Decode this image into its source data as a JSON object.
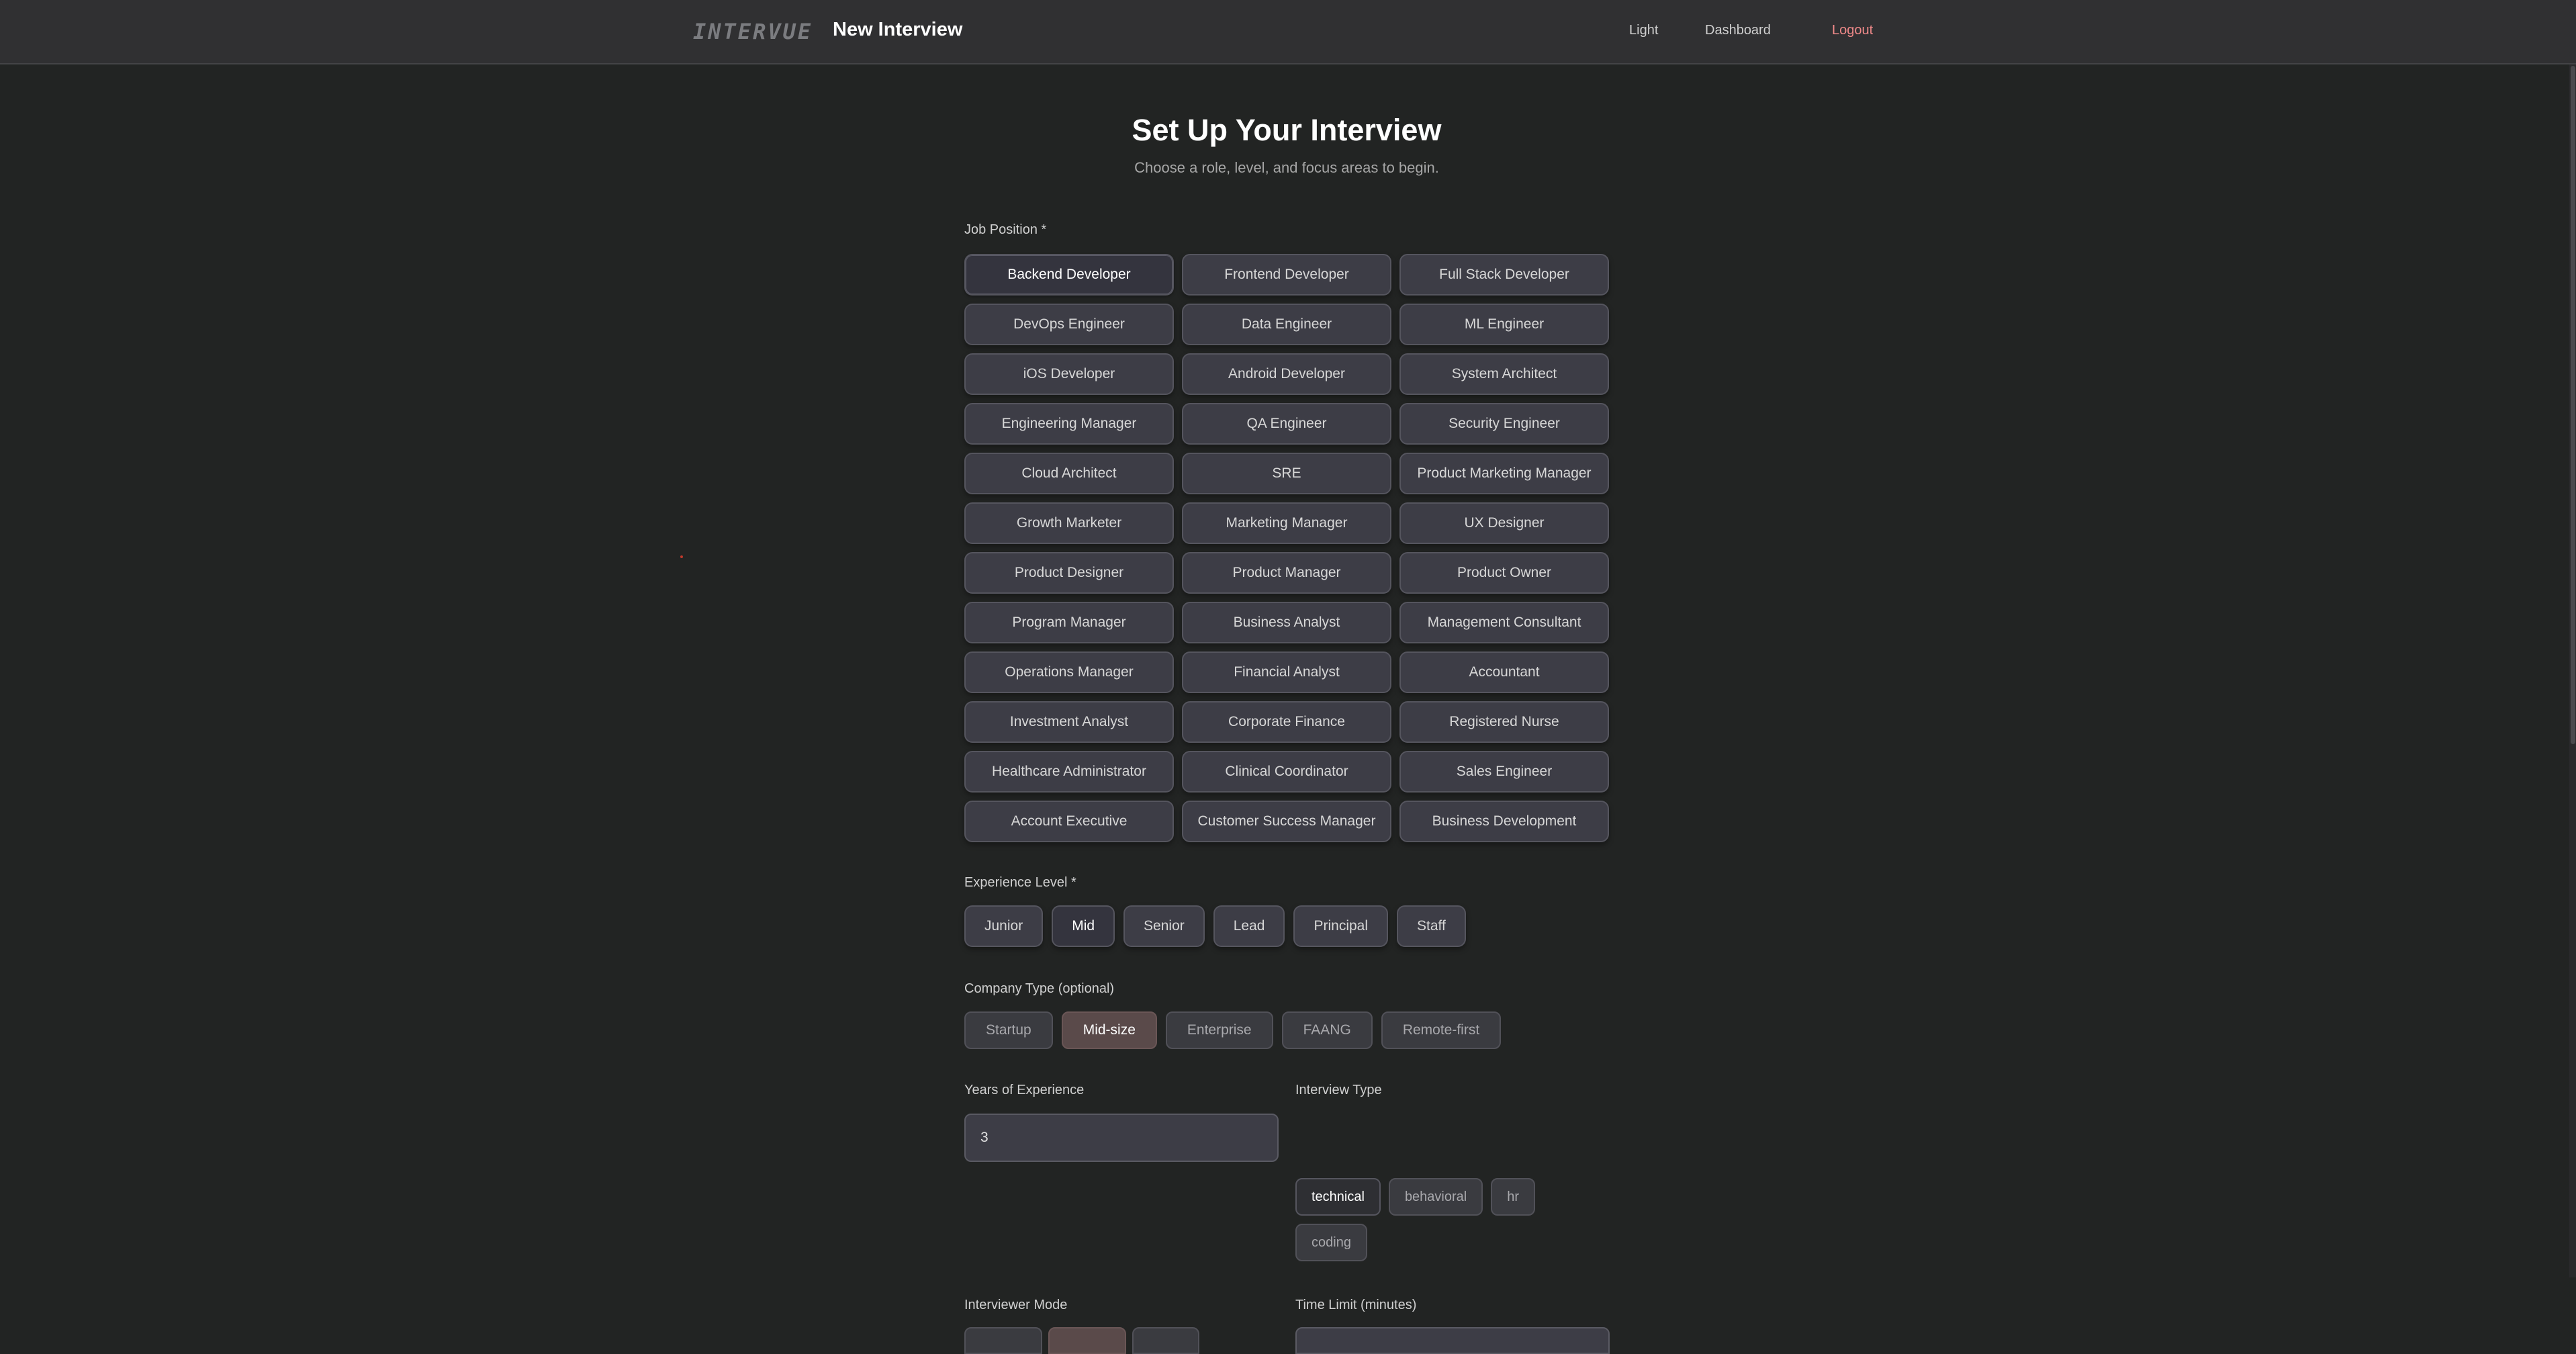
{
  "header": {
    "logo": "INTERVUE",
    "title": "New Interview",
    "links": {
      "light": "Light",
      "dashboard": "Dashboard",
      "logout": "Logout"
    }
  },
  "page": {
    "title": "Set Up Your Interview",
    "subtitle": "Choose a role, level, and focus areas to begin."
  },
  "job_position": {
    "label": "Job Position *",
    "selected": "Backend Developer",
    "options": [
      "Backend Developer",
      "Frontend Developer",
      "Full Stack Developer",
      "DevOps Engineer",
      "Data Engineer",
      "ML Engineer",
      "iOS Developer",
      "Android Developer",
      "System Architect",
      "Engineering Manager",
      "QA Engineer",
      "Security Engineer",
      "Cloud Architect",
      "SRE",
      "Product Marketing Manager",
      "Growth Marketer",
      "Marketing Manager",
      "UX Designer",
      "Product Designer",
      "Product Manager",
      "Product Owner",
      "Program Manager",
      "Business Analyst",
      "Management Consultant",
      "Operations Manager",
      "Financial Analyst",
      "Accountant",
      "Investment Analyst",
      "Corporate Finance",
      "Registered Nurse",
      "Healthcare Administrator",
      "Clinical Coordinator",
      "Sales Engineer",
      "Account Executive",
      "Customer Success Manager",
      "Business Development"
    ]
  },
  "experience_level": {
    "label": "Experience Level *",
    "selected": "Mid",
    "options": [
      "Junior",
      "Mid",
      "Senior",
      "Lead",
      "Principal",
      "Staff"
    ]
  },
  "company_type": {
    "label": "Company Type (optional)",
    "selected": "Mid-size",
    "options": [
      "Startup",
      "Mid-size",
      "Enterprise",
      "FAANG",
      "Remote-first"
    ]
  },
  "years_of_experience": {
    "label": "Years of Experience",
    "value": "3"
  },
  "interview_type": {
    "label": "Interview Type",
    "selected": "technical",
    "options": [
      "technical",
      "behavioral",
      "hr",
      "coding"
    ]
  },
  "interviewer_mode": {
    "label": "Interviewer Mode"
  },
  "time_limit": {
    "label": "Time Limit (minutes)"
  },
  "colors": {
    "background": "#222423",
    "header": "#303032",
    "button": "#3d3d46",
    "accent_selected": "#5a4a4a",
    "logout": "#f08a8a"
  }
}
